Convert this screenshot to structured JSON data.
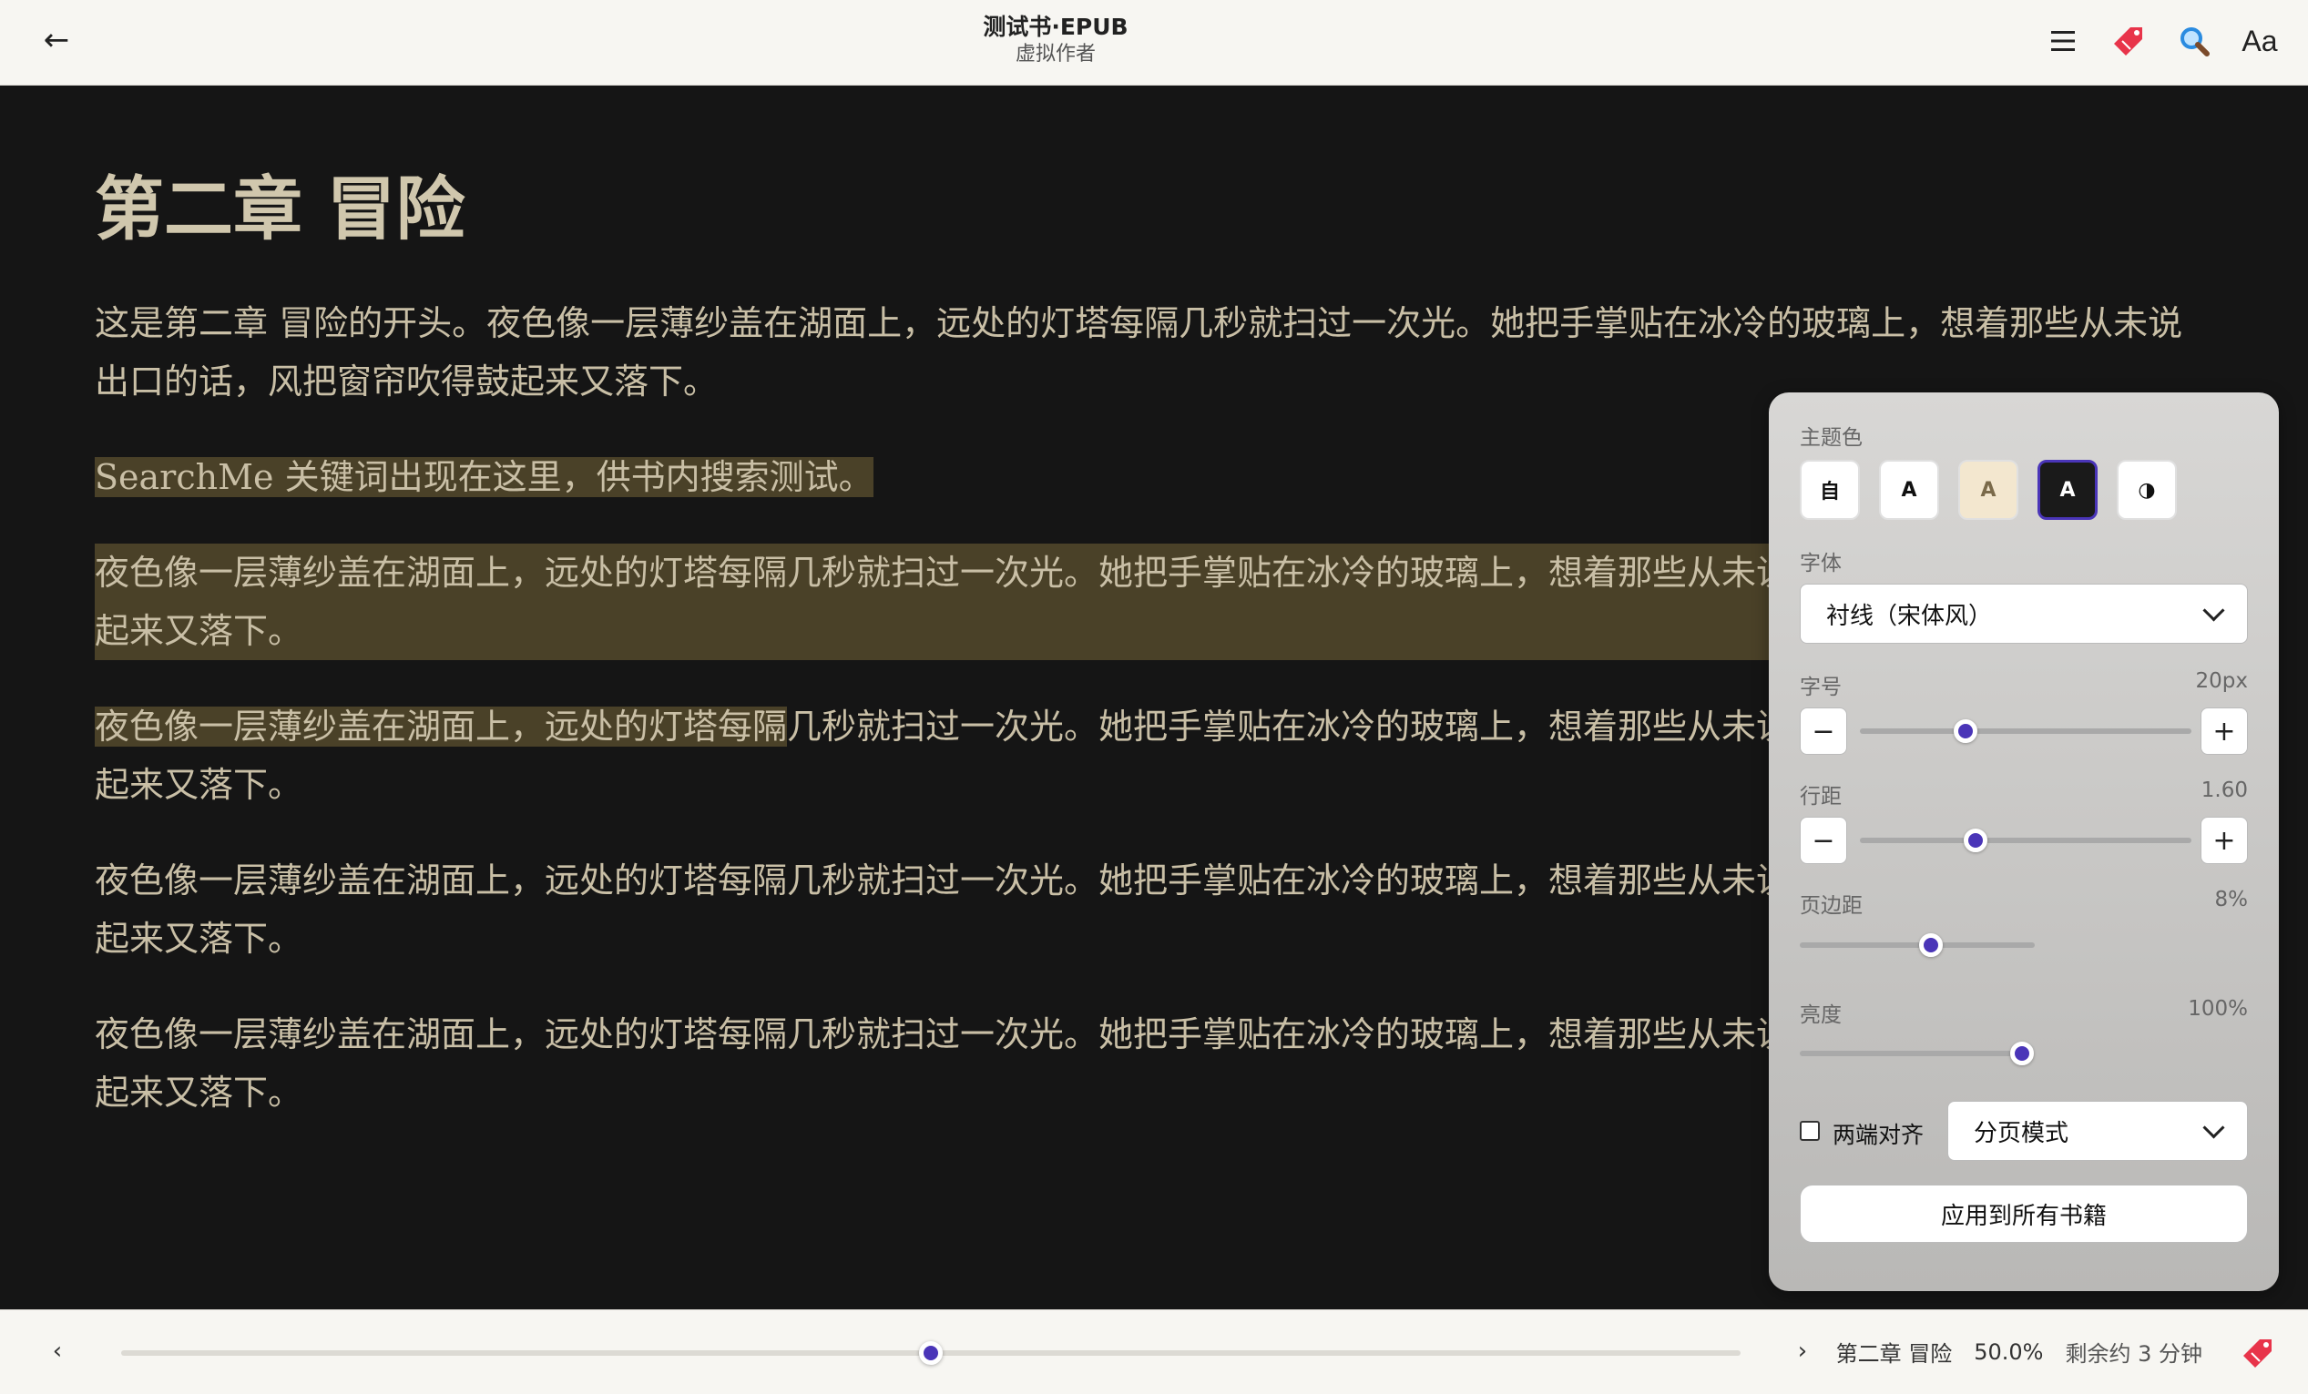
{
  "header": {
    "title": "测试书·EPUB",
    "author": "虚拟作者",
    "icons": [
      "back-arrow-icon",
      "toc-menu-icon",
      "bookmark-icon",
      "search-icon",
      "font-settings-icon"
    ],
    "font_button_label": "Aa"
  },
  "content": {
    "chapter_title": "第二章 冒险",
    "paragraphs": [
      {
        "text": "这是第二章 冒险的开头。夜色像一层薄纱盖在湖面上，远处的灯塔每隔几秒就扫过一次光。她把手掌贴在冰冷的玻璃上，想着那些从未说出口的话，风把窗帘吹得鼓起来又落下。"
      },
      {
        "highlight": "SearchMe 关键词出现在这里，供书内搜索测试。"
      },
      {
        "text": "夜色像一层薄纱盖在湖面上，远处的灯塔每隔几秒就扫过一次光。她把手掌贴在冰冷的玻璃上，想着那些从未说出口的话，风把窗帘吹得鼓起来又落下。"
      },
      {
        "highlight": "夜色像一层薄纱盖在湖面上，远处的灯塔每隔",
        "rest": "几秒就扫过一次光。她把手掌贴在冰冷的玻璃上，想着那些从未说出口的话，风把窗帘吹得鼓起来又落下。"
      },
      {
        "text": "夜色像一层薄纱盖在湖面上，远处的灯塔每隔几秒就扫过一次光。她把手掌贴在冰冷的玻璃上，想着那些从未说出口的话，风把窗帘吹得鼓起来又落下。"
      },
      {
        "text": "夜色像一层薄纱盖在湖面上，远处的灯塔每隔几秒就扫过一次光。她把手掌贴在冰冷的玻璃上，想着那些从未说出口的话，风把窗帘吹得鼓起来又落下。"
      }
    ]
  },
  "settings": {
    "theme_label": "主题色",
    "themes": [
      {
        "label": "自",
        "bg": "#ffffff",
        "fg": "#111111"
      },
      {
        "label": "A",
        "bg": "#ffffff",
        "fg": "#111111"
      },
      {
        "label": "A",
        "bg": "#f3e7cf",
        "fg": "#7a6a4a"
      },
      {
        "label": "A",
        "bg": "#1a1a1a",
        "fg": "#ffffff",
        "selected": true
      },
      {
        "label": "◑",
        "bg": "#ffffff",
        "fg": "#111111"
      }
    ],
    "font_label": "字体",
    "font_value": "衬线（宋体风）",
    "size_label": "字号",
    "size_value": "20px",
    "size_level": 0.32,
    "line_label": "行距",
    "line_value": "1.60",
    "line_level": 0.35,
    "margin_label": "页边距",
    "margin_value": "8%",
    "margin_level": 0.56,
    "brightness_label": "亮度",
    "brightness_value": "100%",
    "brightness_level": 1.0,
    "minus_label": "−",
    "plus_label": "+",
    "justify_label": "两端对齐",
    "justify_checked": false,
    "mode_value": "分页模式",
    "apply_label": "应用到所有书籍"
  },
  "footer": {
    "prev": "‹",
    "next": "›",
    "chapter": "第二章 冒险",
    "percent": "50.0%",
    "progress": 0.5,
    "remaining": "剩余约 3 分钟"
  },
  "colors": {
    "accent": "#4a35b8",
    "highlight": "#4a4128",
    "bookmark": "#e8344a",
    "search": "#2a8be0"
  }
}
